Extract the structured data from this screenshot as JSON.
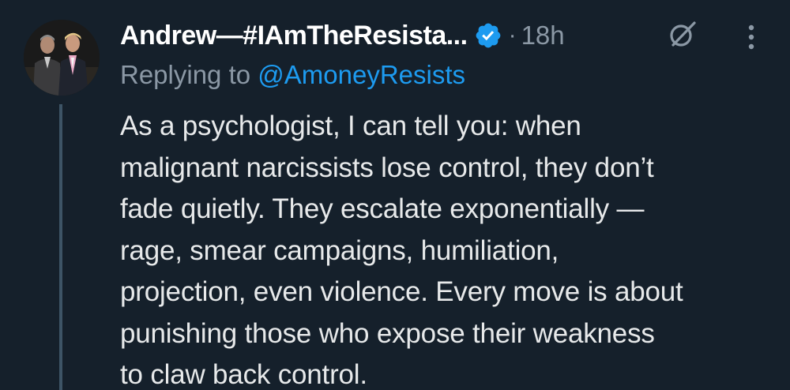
{
  "tweet": {
    "display_name": "Andrew—#IAmTheResista...",
    "separator": "·",
    "time": "18h",
    "replying_prefix": "Replying to ",
    "replying_handle": "@AmoneyResists",
    "body_lines": [
      "As a psychologist, I can tell you: when",
      "malignant narcissists lose control, they don’t",
      "fade quietly. They escalate exponentially —",
      "rage, smear campaigns, humiliation,",
      "projection, even violence. Every move is about",
      "punishing those who expose their weakness",
      "to claw back control."
    ]
  },
  "icons": {
    "verified": "verified-badge-icon",
    "grok": "grok-icon",
    "more": "more-options-icon"
  },
  "colors": {
    "background": "#15202b",
    "accent": "#1d9bf0",
    "muted": "#8b98a5",
    "text": "#e7e9ea",
    "thread_line": "#3d5466"
  }
}
